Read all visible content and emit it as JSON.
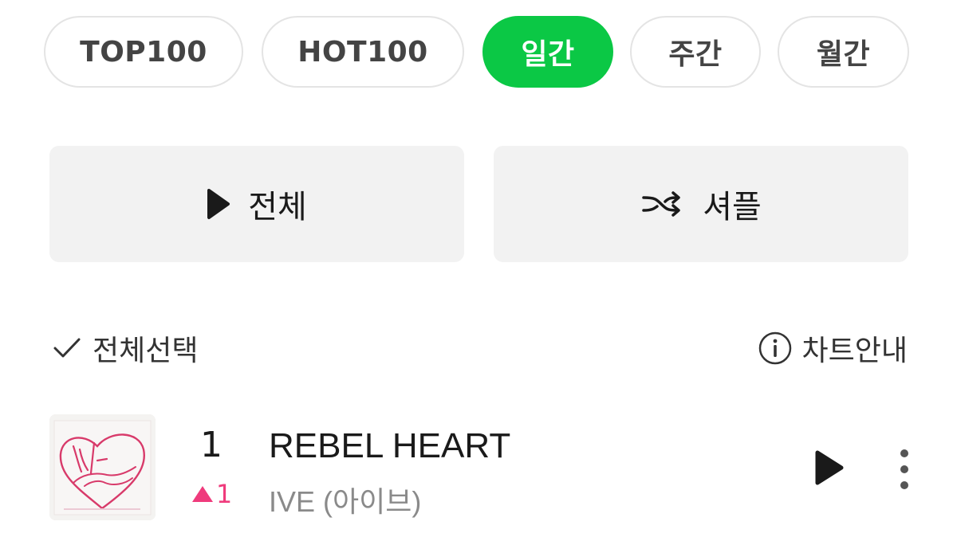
{
  "tabs": [
    {
      "label": "TOP100",
      "active": false
    },
    {
      "label": "HOT100",
      "active": false
    },
    {
      "label": "일간",
      "active": true
    },
    {
      "label": "주간",
      "active": false
    },
    {
      "label": "월간",
      "active": false
    }
  ],
  "actions": {
    "play_all_label": "전체",
    "shuffle_label": "셔플"
  },
  "toolbar": {
    "select_all_label": "전체선택",
    "chart_info_label": "차트안내"
  },
  "songs": [
    {
      "rank": "1",
      "rank_change": "1",
      "rank_change_direction": "up",
      "title": "REBEL HEART",
      "artist": "IVE (아이브)"
    }
  ],
  "colors": {
    "accent": "#0bc845",
    "rank_up": "#ef3b7c",
    "button_bg": "#f2f2f2"
  }
}
